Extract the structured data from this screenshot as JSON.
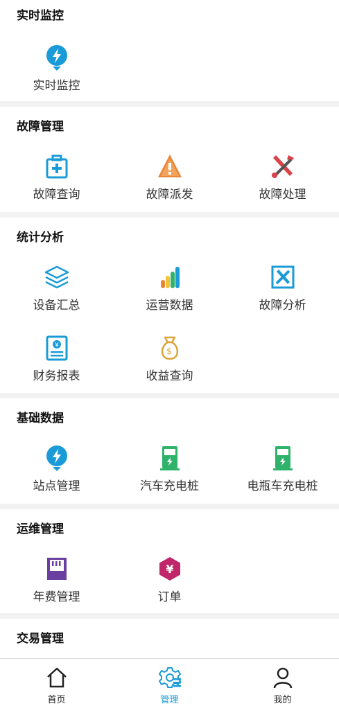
{
  "sections": {
    "monitor": {
      "title": "实时监控",
      "items": [
        "实时监控"
      ]
    },
    "fault": {
      "title": "故障管理",
      "items": [
        "故障查询",
        "故障派发",
        "故障处理"
      ]
    },
    "stats": {
      "title": "统计分析",
      "items": [
        "设备汇总",
        "运营数据",
        "故障分析",
        "财务报表",
        "收益查询"
      ]
    },
    "base": {
      "title": "基础数据",
      "items": [
        "站点管理",
        "汽车充电桩",
        "电瓶车充电桩"
      ]
    },
    "ops": {
      "title": "运维管理",
      "items": [
        "年费管理",
        "订单"
      ]
    },
    "trade": {
      "title": "交易管理"
    }
  },
  "tabbar": {
    "home": "首页",
    "manage": "管理",
    "mine": "我的",
    "active": "manage"
  },
  "colors": {
    "blue": "#1a9bd7",
    "orange": "#e8873a",
    "red": "#d9434a",
    "green": "#2fb36b",
    "purple": "#6b3fa0",
    "magenta": "#c0266a",
    "gold": "#d9a53a"
  },
  "icons": {
    "monitor": "lightning-pin-icon",
    "fault_query": "first-aid-box-icon",
    "fault_dispatch": "warning-triangle-icon",
    "fault_handle": "tools-cross-icon",
    "equipment_summary": "layers-icon",
    "operation_data": "bar-chart-icon",
    "fault_analysis": "tools-box-icon",
    "financial_report": "yuan-document-icon",
    "revenue_query": "money-bag-icon",
    "site_management": "lightning-pin-icon",
    "car_charger": "charging-pile-icon",
    "ebike_charger": "charging-pile-icon",
    "annual_fee": "sd-card-icon",
    "order": "yuan-hexagon-icon"
  }
}
